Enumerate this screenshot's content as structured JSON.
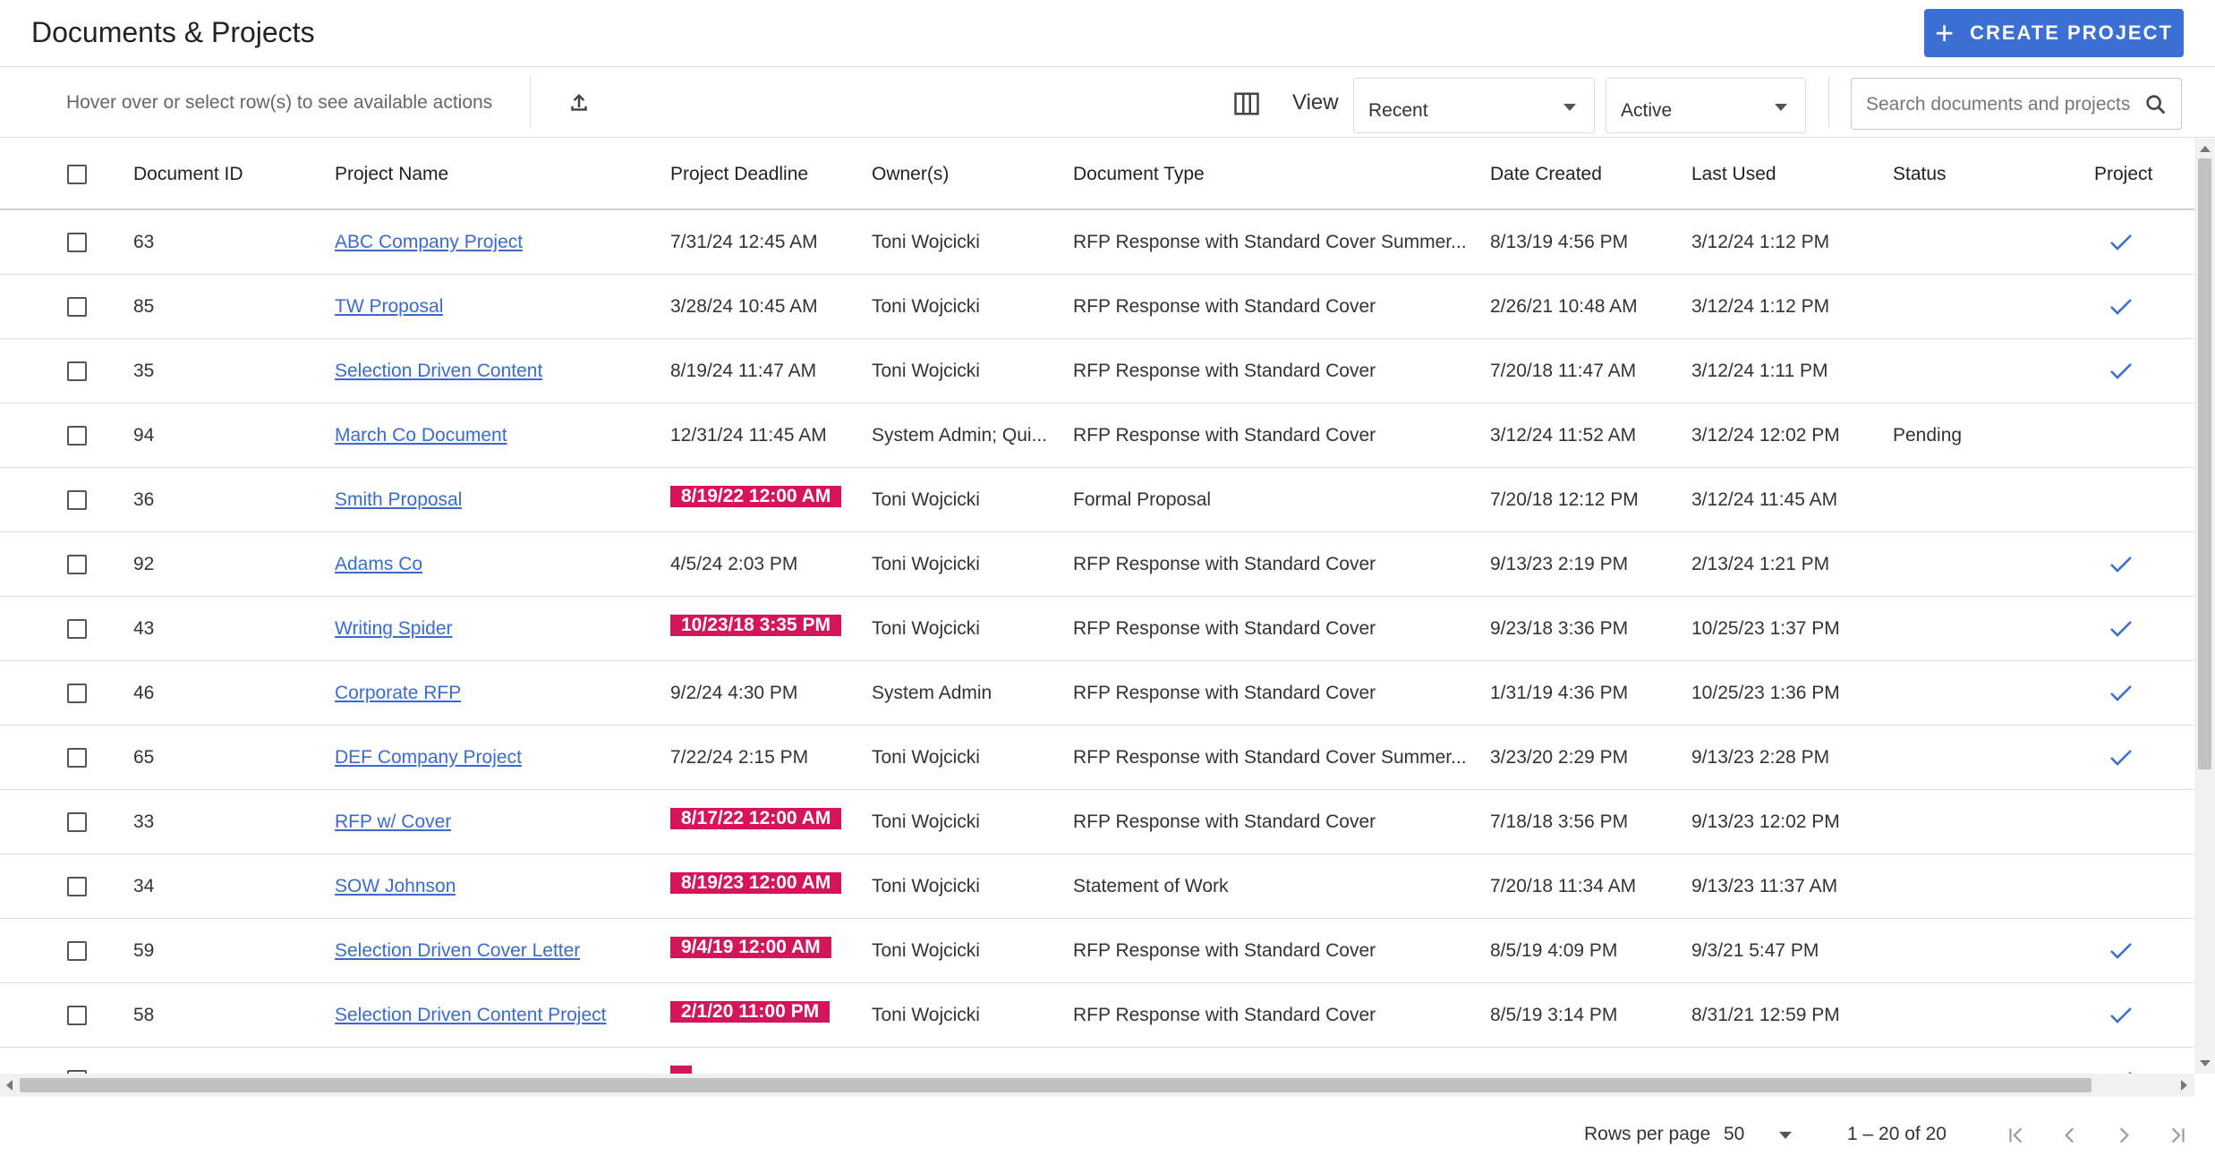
{
  "header": {
    "title": "Documents & Projects",
    "create_label": "CREATE PROJECT"
  },
  "toolbar": {
    "hint": "Hover over or select row(s) to see available actions",
    "view_label": "View",
    "view_select": "Recent",
    "status_select": "Active",
    "search_placeholder": "Search documents and projects"
  },
  "table": {
    "columns": [
      "Document ID",
      "Project Name",
      "Project Deadline",
      "Owner(s)",
      "Document Type",
      "Date Created",
      "Last Used",
      "Status",
      "Project"
    ],
    "rows": [
      {
        "id": "63",
        "name": "ABC Company Project",
        "deadline": "7/31/24 12:45 AM",
        "overdue": false,
        "owner": "Toni Wojcicki",
        "type": "RFP Response with Standard Cover Summer...",
        "created": "8/13/19 4:56 PM",
        "last_used": "3/12/24 1:12 PM",
        "status": "",
        "project": true
      },
      {
        "id": "85",
        "name": "TW Proposal",
        "deadline": "3/28/24 10:45 AM",
        "overdue": false,
        "owner": "Toni Wojcicki",
        "type": "RFP Response with Standard Cover",
        "created": "2/26/21 10:48 AM",
        "last_used": "3/12/24 1:12 PM",
        "status": "",
        "project": true
      },
      {
        "id": "35",
        "name": "Selection Driven Content",
        "deadline": "8/19/24 11:47 AM",
        "overdue": false,
        "owner": "Toni Wojcicki",
        "type": "RFP Response with Standard Cover",
        "created": "7/20/18 11:47 AM",
        "last_used": "3/12/24 1:11 PM",
        "status": "",
        "project": true
      },
      {
        "id": "94",
        "name": "March Co Document",
        "deadline": "12/31/24 11:45 AM",
        "overdue": false,
        "owner": "System Admin; Qui...",
        "type": "RFP Response with Standard Cover",
        "created": "3/12/24 11:52 AM",
        "last_used": "3/12/24 12:02 PM",
        "status": "Pending",
        "project": false
      },
      {
        "id": "36",
        "name": "Smith Proposal",
        "deadline": "8/19/22 12:00 AM",
        "overdue": true,
        "owner": "Toni Wojcicki",
        "type": "Formal Proposal",
        "created": "7/20/18 12:12 PM",
        "last_used": "3/12/24 11:45 AM",
        "status": "",
        "project": false
      },
      {
        "id": "92",
        "name": "Adams Co",
        "deadline": "4/5/24 2:03 PM",
        "overdue": false,
        "owner": "Toni Wojcicki",
        "type": "RFP Response with Standard Cover",
        "created": "9/13/23 2:19 PM",
        "last_used": "2/13/24 1:21 PM",
        "status": "",
        "project": true
      },
      {
        "id": "43",
        "name": "Writing Spider",
        "deadline": "10/23/18 3:35 PM",
        "overdue": true,
        "owner": "Toni Wojcicki",
        "type": "RFP Response with Standard Cover",
        "created": "9/23/18 3:36 PM",
        "last_used": "10/25/23 1:37 PM",
        "status": "",
        "project": true
      },
      {
        "id": "46",
        "name": "Corporate RFP",
        "deadline": "9/2/24 4:30 PM",
        "overdue": false,
        "owner": "System Admin",
        "type": "RFP Response with Standard Cover",
        "created": "1/31/19 4:36 PM",
        "last_used": "10/25/23 1:36 PM",
        "status": "",
        "project": true
      },
      {
        "id": "65",
        "name": "DEF Company Project",
        "deadline": "7/22/24 2:15 PM",
        "overdue": false,
        "owner": "Toni Wojcicki",
        "type": "RFP Response with Standard Cover Summer...",
        "created": "3/23/20 2:29 PM",
        "last_used": "9/13/23 2:28 PM",
        "status": "",
        "project": true
      },
      {
        "id": "33",
        "name": "RFP w/ Cover",
        "deadline": "8/17/22 12:00 AM",
        "overdue": true,
        "owner": "Toni Wojcicki",
        "type": "RFP Response with Standard Cover",
        "created": "7/18/18 3:56 PM",
        "last_used": "9/13/23 12:02 PM",
        "status": "",
        "project": false
      },
      {
        "id": "34",
        "name": "SOW Johnson",
        "deadline": "8/19/23 12:00 AM",
        "overdue": true,
        "owner": "Toni Wojcicki",
        "type": "Statement of Work",
        "created": "7/20/18 11:34 AM",
        "last_used": "9/13/23 11:37 AM",
        "status": "",
        "project": false
      },
      {
        "id": "59",
        "name": "Selection Driven Cover Letter",
        "deadline": "9/4/19 12:00 AM",
        "overdue": true,
        "owner": "Toni Wojcicki",
        "type": "RFP Response with Standard Cover",
        "created": "8/5/19 4:09 PM",
        "last_used": "9/3/21 5:47 PM",
        "status": "",
        "project": true
      },
      {
        "id": "58",
        "name": "Selection Driven Content Project",
        "deadline": "2/1/20 11:00 PM",
        "overdue": true,
        "owner": "Toni Wojcicki",
        "type": "RFP Response with Standard Cover",
        "created": "8/5/19 3:14 PM",
        "last_used": "8/31/21 12:59 PM",
        "status": "",
        "project": true
      },
      {
        "id": "",
        "name": "",
        "deadline": "",
        "overdue": true,
        "owner": "",
        "type": "",
        "created": "",
        "last_used": "",
        "status": "",
        "project": true
      }
    ]
  },
  "footer": {
    "rows_per_page_label": "Rows per page",
    "rows_per_page": "50",
    "range": "1 – 20 of 20"
  },
  "colors": {
    "accent": "#3b6fd4",
    "link": "#3a6bd0",
    "overdue": "#d6145a"
  },
  "icons": [
    "plus-icon",
    "upload-icon",
    "columns-icon",
    "chevron-down-icon",
    "search-icon",
    "check-icon",
    "first-page-icon",
    "previous-page-icon",
    "next-page-icon",
    "last-page-icon"
  ]
}
